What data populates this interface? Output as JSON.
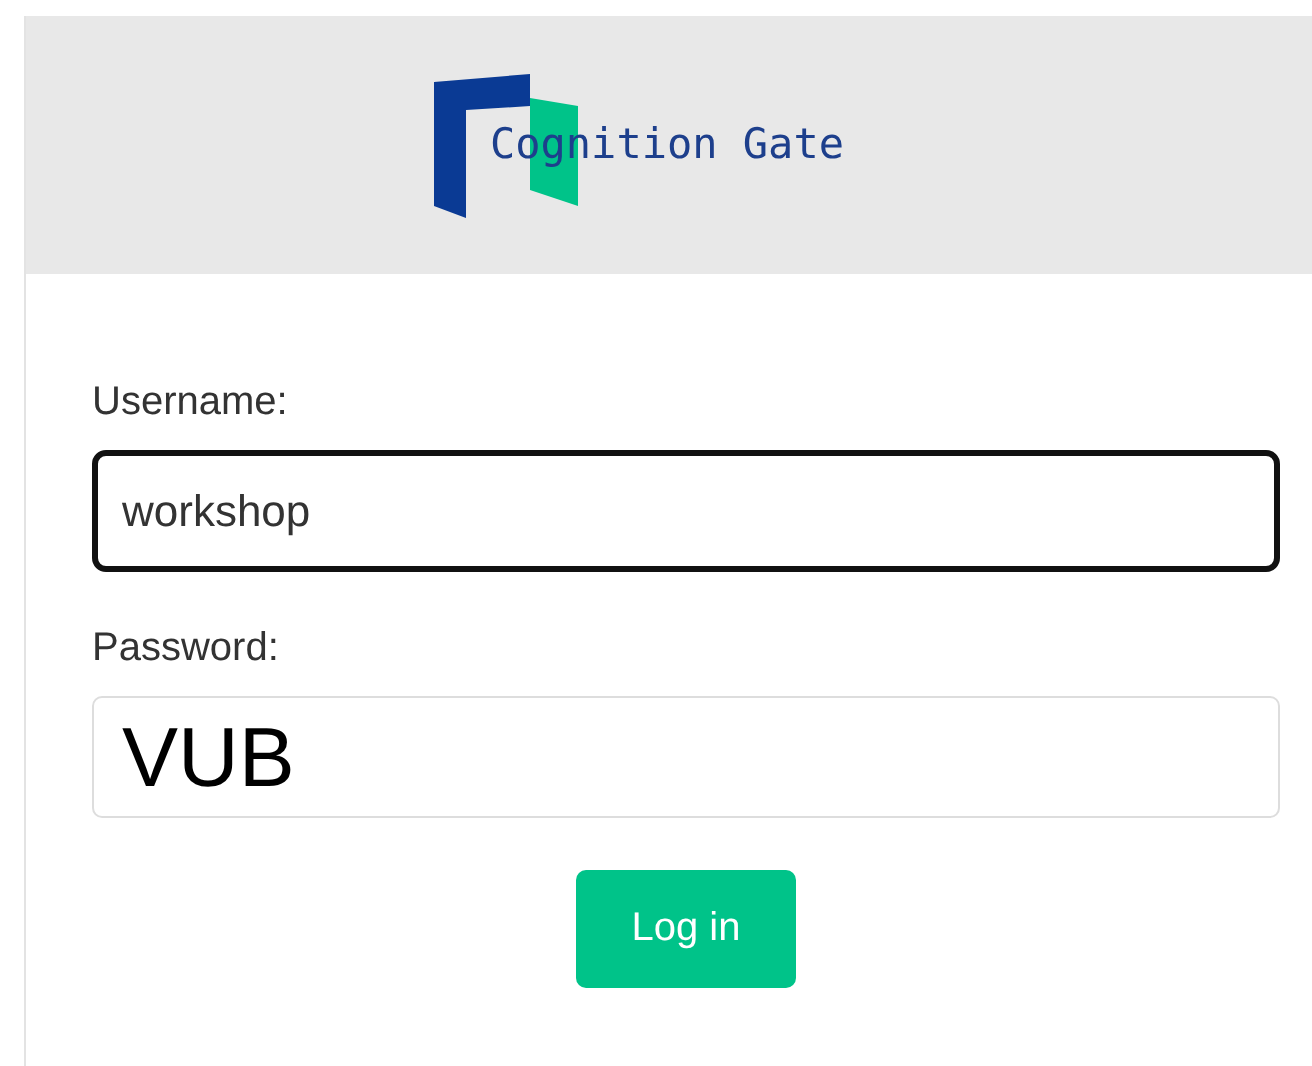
{
  "logo": {
    "text": "Cognition Gate"
  },
  "fields": [
    {
      "kind": "text",
      "label": "Username:",
      "value": "workshop",
      "focused": true
    },
    {
      "kind": "password",
      "label": "Password:",
      "value": "VUB",
      "focused": false
    }
  ],
  "button": {
    "label": "Log in"
  }
}
